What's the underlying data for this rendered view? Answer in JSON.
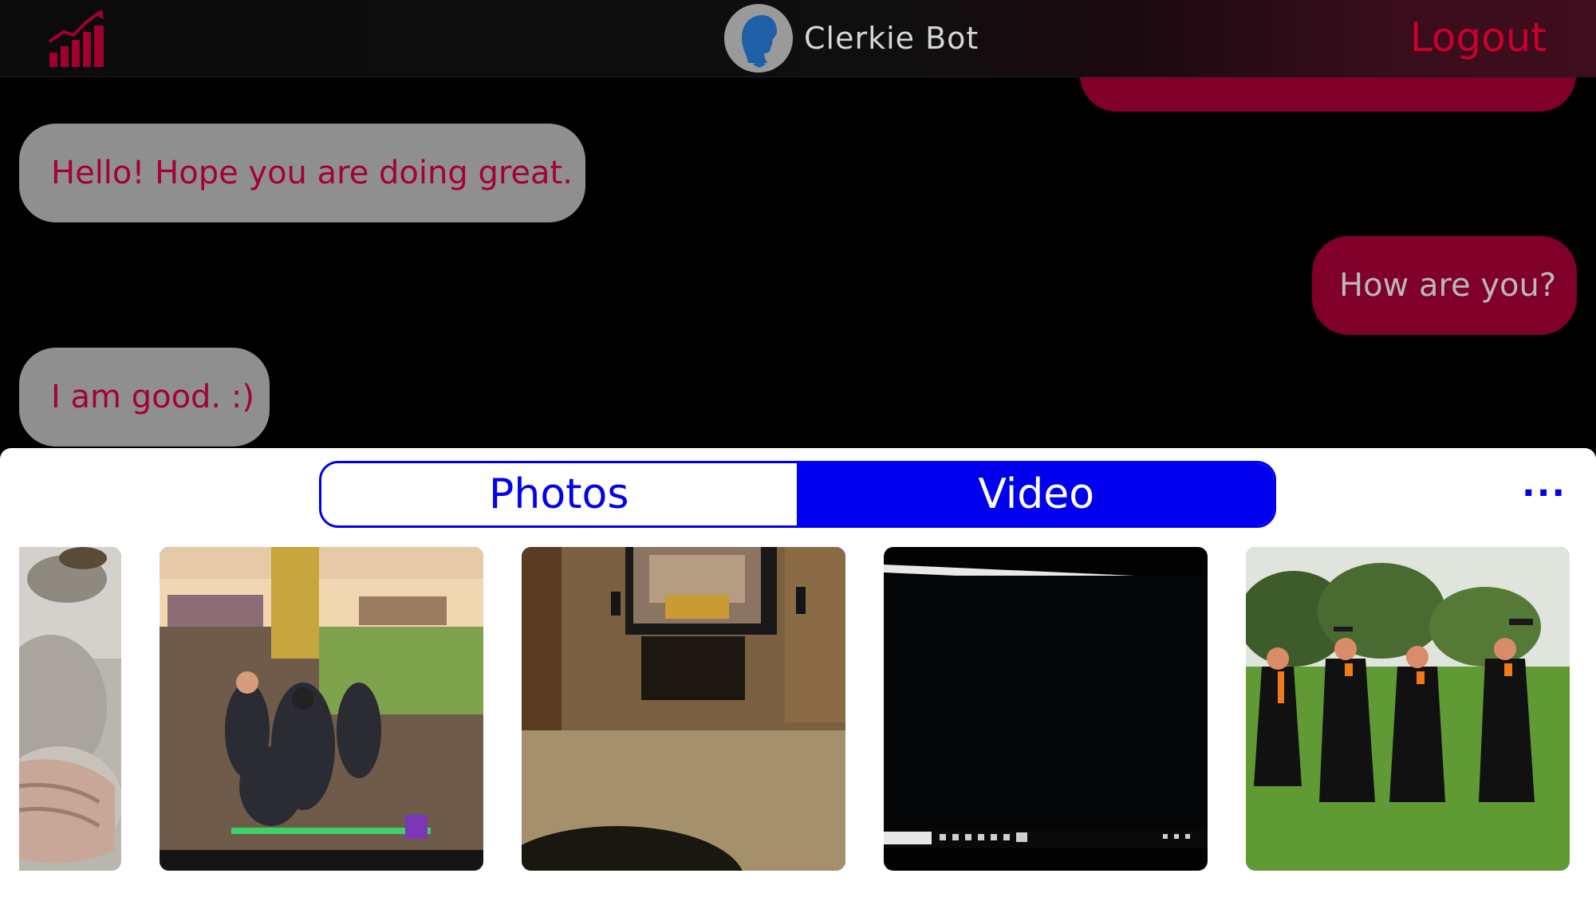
{
  "header": {
    "stats_icon": "bar-chart-trend-icon",
    "avatar_icon": "person-silhouette-icon",
    "bot_name": "Clerkie Bot",
    "logout_label": "Logout"
  },
  "colors": {
    "accent_red": "#c8002d",
    "user_bubble": "#80002a",
    "bot_bubble": "#8f8f8f",
    "bot_text": "#a4003a",
    "segment_blue": "#0000ee"
  },
  "chat": {
    "messages": [
      {
        "sender": "user",
        "text": ""
      },
      {
        "sender": "bot",
        "text": "Hello! Hope you are doing great."
      },
      {
        "sender": "user",
        "text": "How are you?"
      },
      {
        "sender": "bot",
        "text": "I am good. :)"
      }
    ]
  },
  "media_picker": {
    "tabs": [
      {
        "label": "Photos",
        "selected": false
      },
      {
        "label": "Video",
        "selected": true
      }
    ],
    "more_label": "...",
    "thumbnails": [
      {
        "subject": "fluffy pet fur close-up"
      },
      {
        "subject": "video game characters on a TV screen"
      },
      {
        "subject": "living room with television"
      },
      {
        "subject": "dark computer monitor screen"
      },
      {
        "subject": "graduates in gowns tossing caps outdoors"
      }
    ]
  }
}
